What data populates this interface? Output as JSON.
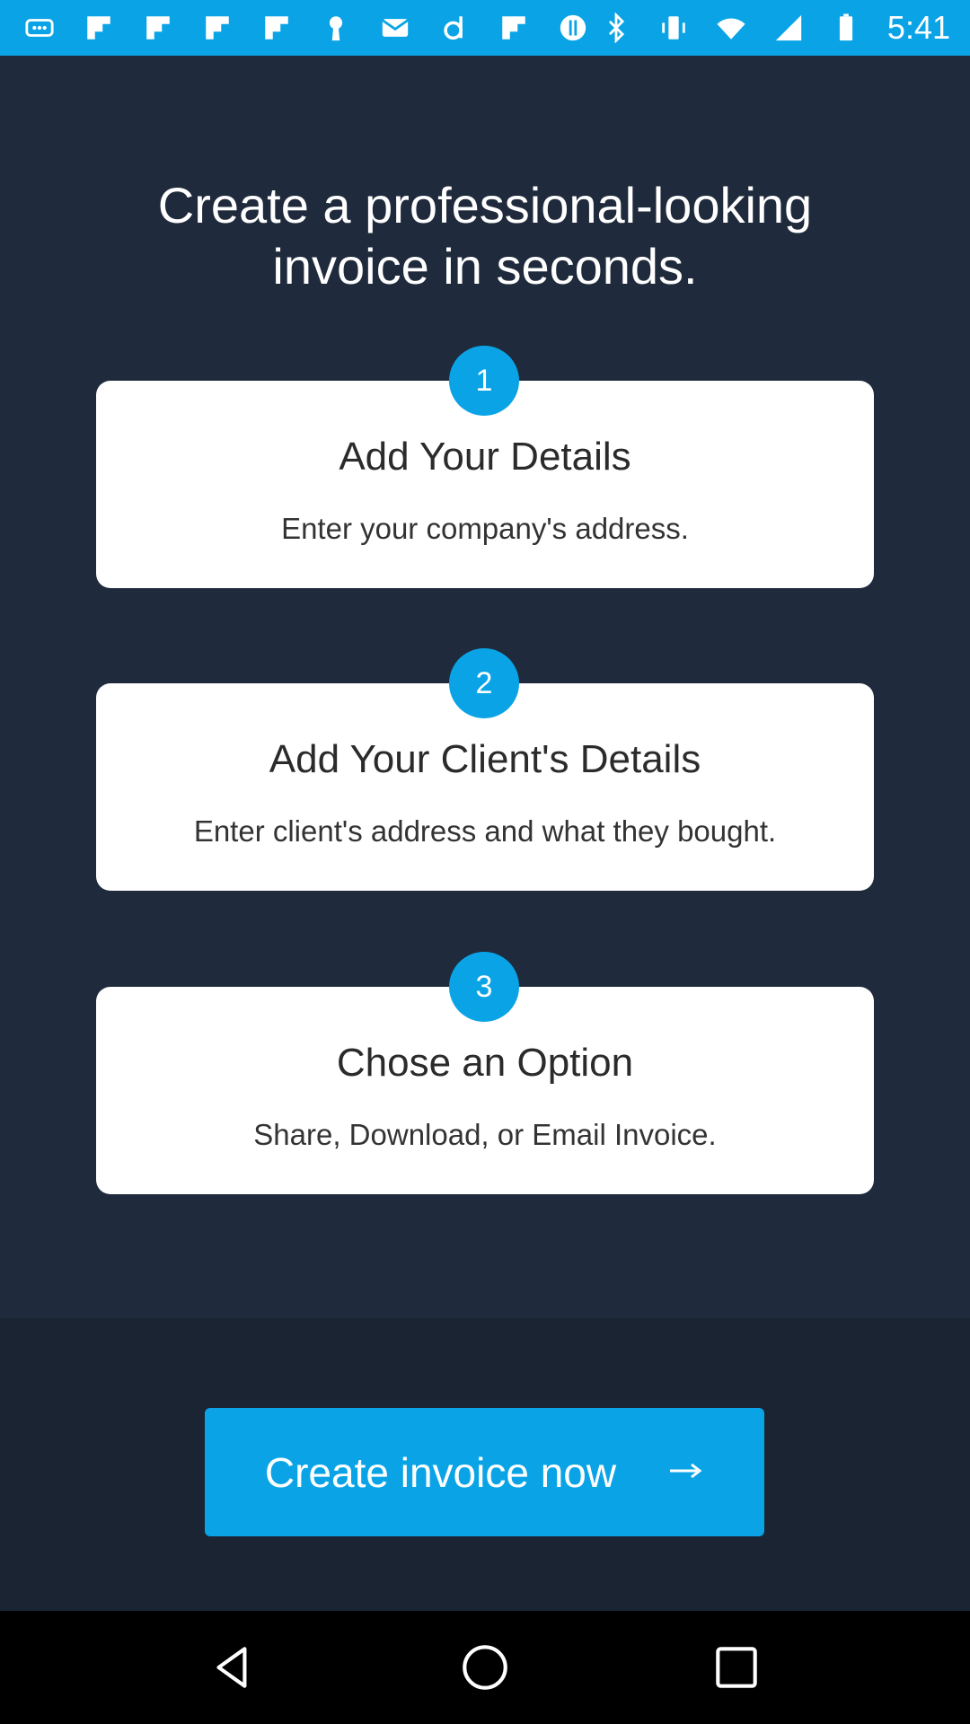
{
  "status_bar": {
    "time": "5:41",
    "icons": [
      "more-icon",
      "flipboard-icon",
      "flipboard-icon",
      "flipboard-icon",
      "flipboard-icon",
      "keyhole-icon",
      "mail-icon",
      "d-icon",
      "flipboard-icon",
      "alert-circle-icon",
      "bluetooth-icon",
      "vibrate-icon",
      "wifi-icon",
      "signal-icon",
      "battery-icon"
    ]
  },
  "headline": {
    "line1": "Create a professional-looking",
    "line2": "invoice in seconds."
  },
  "steps": [
    {
      "number": "1",
      "title": "Add Your Details",
      "description": "Enter your company's address."
    },
    {
      "number": "2",
      "title": "Add Your Client's Details",
      "description": "Enter client's address and what they bought."
    },
    {
      "number": "3",
      "title": "Chose an Option",
      "description": "Share, Download, or Email Invoice."
    }
  ],
  "cta": {
    "label": "Create invoice now",
    "icon": "arrow-right-icon"
  },
  "colors": {
    "accent": "#0aa4e6",
    "background": "#1f2a3c",
    "bottom_panel": "#1a2433",
    "card": "#ffffff"
  },
  "nav_bar": {
    "icons": [
      "back-icon",
      "home-icon",
      "recents-icon"
    ]
  }
}
